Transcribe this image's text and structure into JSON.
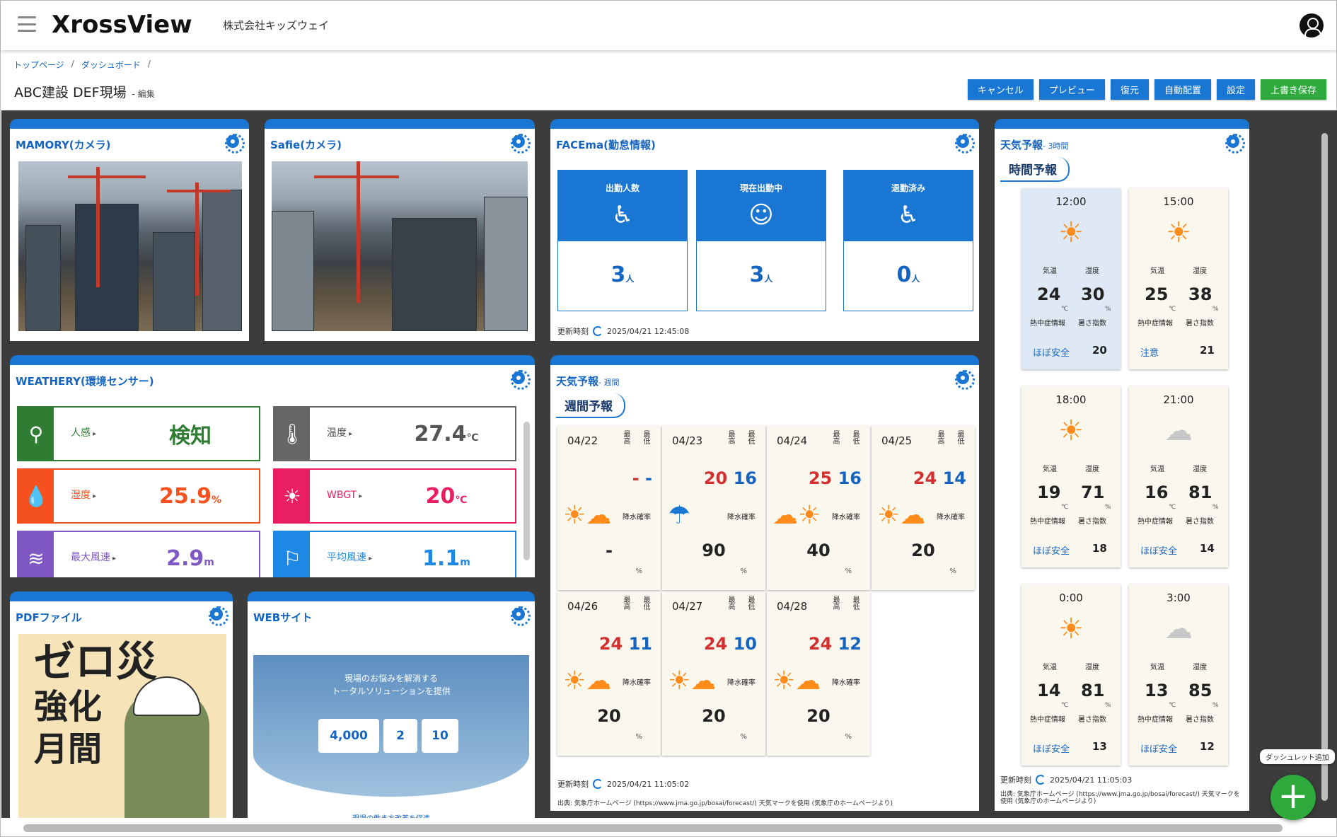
{
  "header": {
    "logo": "XrossView",
    "company": "株式会社キッズウェイ"
  },
  "breadcrumb": [
    "トップページ",
    "ダッシュボード"
  ],
  "page": {
    "title": "ABC建設 DEF現場",
    "mode": "- 編集"
  },
  "actions": {
    "cancel": "キャンセル",
    "preview": "プレビュー",
    "restore": "復元",
    "auto": "自動配置",
    "settings": "設定",
    "save": "上書き保存"
  },
  "cam1": {
    "title": "MAMORY(カメラ)"
  },
  "cam2": {
    "title": "Safie(カメラ)"
  },
  "face": {
    "title": "FACEma(勤怠情報)",
    "cards": [
      {
        "label": "出勤人数",
        "value": "3",
        "unit": "人"
      },
      {
        "label": "現在出勤中",
        "value": "3",
        "unit": "人"
      },
      {
        "label": "退勤済み",
        "value": "0",
        "unit": "人"
      }
    ],
    "updated_label": "更新時刻",
    "updated": "2025/04/21 12:45:08"
  },
  "sensor": {
    "title": "WEATHERY(環境センサー)",
    "items": [
      {
        "label": "人感",
        "value": "検知",
        "unit": ""
      },
      {
        "label": "温度",
        "value": "27.4",
        "unit": "℃"
      },
      {
        "label": "湿度",
        "value": "25.9",
        "unit": "%"
      },
      {
        "label": "WBGT",
        "value": "20",
        "unit": "℃"
      },
      {
        "label": "最大風速",
        "value": "2.9",
        "unit": "m"
      },
      {
        "label": "平均風速",
        "value": "1.1",
        "unit": "m"
      }
    ]
  },
  "weekly": {
    "title": "天気予報",
    "sub": "- 週間",
    "tab": "週間予報",
    "hi_label": "最高",
    "lo_label": "最低",
    "rain_label": "降水確率",
    "pct": "%",
    "days": [
      {
        "date": "04/22",
        "hi": "-",
        "lo": "-",
        "rain": "-"
      },
      {
        "date": "04/23",
        "hi": "20",
        "lo": "16",
        "rain": "90"
      },
      {
        "date": "04/24",
        "hi": "25",
        "lo": "16",
        "rain": "40"
      },
      {
        "date": "04/25",
        "hi": "24",
        "lo": "14",
        "rain": "20"
      },
      {
        "date": "04/26",
        "hi": "24",
        "lo": "11",
        "rain": "20"
      },
      {
        "date": "04/27",
        "hi": "24",
        "lo": "10",
        "rain": "20"
      },
      {
        "date": "04/28",
        "hi": "24",
        "lo": "12",
        "rain": "20"
      }
    ],
    "updated_label": "更新時刻",
    "updated": "2025/04/21 11:05:02",
    "source": "出典: 気象庁ホームページ (https://www.jma.go.jp/bosai/forecast/) 天気マークを使用 (気象庁のホームページより)"
  },
  "hourly": {
    "title": "天気予報",
    "sub": "- 3時間",
    "tab": "時間予報",
    "temp_label": "気温",
    "hum_label": "湿度",
    "heat_label": "熱中症情報",
    "idx_label": "暑さ指数",
    "c": "℃",
    "pct": "%",
    "slots": [
      {
        "time": "12:00",
        "temp": "24",
        "hum": "30",
        "status": "ほぼ安全",
        "idx": "20"
      },
      {
        "time": "15:00",
        "temp": "25",
        "hum": "38",
        "status": "注意",
        "idx": "21"
      },
      {
        "time": "18:00",
        "temp": "19",
        "hum": "71",
        "status": "ほぼ安全",
        "idx": "18"
      },
      {
        "time": "21:00",
        "temp": "16",
        "hum": "81",
        "status": "ほぼ安全",
        "idx": "14"
      },
      {
        "time": "0:00",
        "temp": "14",
        "hum": "81",
        "status": "ほぼ安全",
        "idx": "13"
      },
      {
        "time": "3:00",
        "temp": "13",
        "hum": "85",
        "status": "ほぼ安全",
        "idx": "12"
      }
    ],
    "updated_label": "更新時刻",
    "updated": "2025/04/21 11:05:03",
    "source": "出典: 気象庁ホームページ (https://www.jma.go.jp/bosai/forecast/) 天気マークを使用 (気象庁のホームページより)"
  },
  "pdf": {
    "title": "PDFファイル",
    "line1": "ゼロ災",
    "line2": "強化",
    "line3": "月間"
  },
  "web": {
    "title": "WEBサイト",
    "hero1": "現場のお悩みを解消する",
    "hero2": "トータルソリューションを提供",
    "b1": "4,000",
    "b2": "2",
    "b3": "10",
    "bottom": "現場の働き方改革を促進"
  },
  "fab": {
    "tooltip": "ダッシュレット追加",
    "label": "+"
  }
}
